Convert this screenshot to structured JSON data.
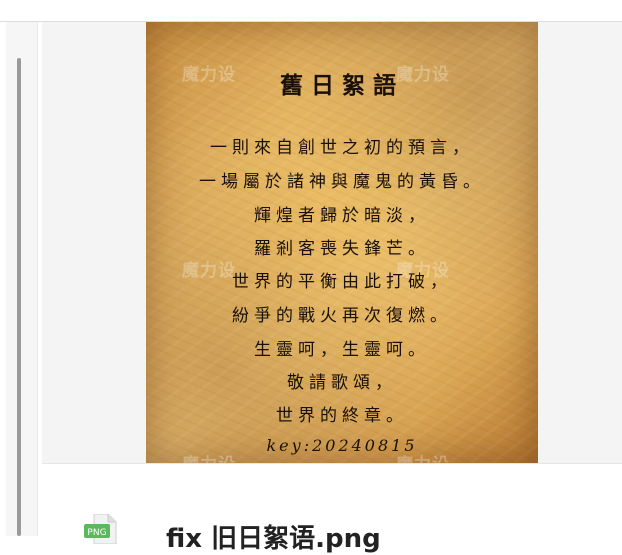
{
  "poem": {
    "title": "舊日絮語",
    "lines": [
      "一則來自創世之初的預言，",
      "一場屬於諸神與魔鬼的黃昏。",
      "輝煌者歸於暗淡，",
      "羅剎客喪失鋒芒。",
      "世界的平衡由此打破，",
      "紛爭的戰火再次復燃。",
      "生靈呵，生靈呵。",
      "敬請歌頌，",
      "世界的終章。"
    ],
    "key": "key:20240815"
  },
  "watermark": {
    "text": "魔力设"
  },
  "file": {
    "type_badge": "PNG",
    "name": "fix 旧日絮语.png",
    "icon": "png-file-icon"
  },
  "colors": {
    "paper": "#e2b566",
    "ink": "#1a1008",
    "badge": "#5cb85c"
  }
}
